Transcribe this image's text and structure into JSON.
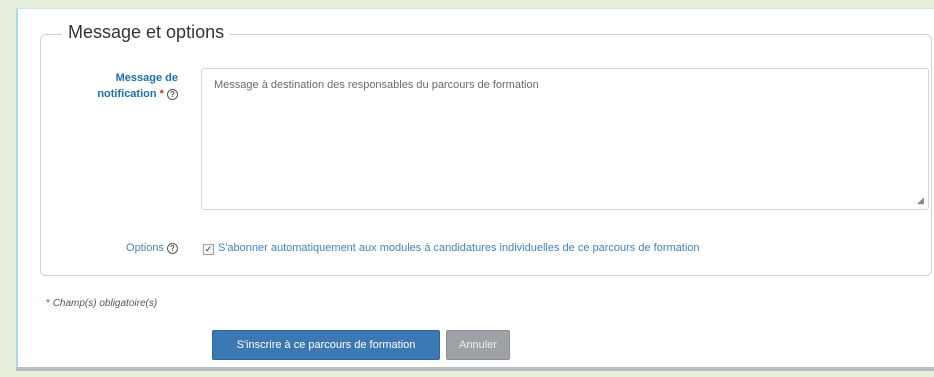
{
  "form": {
    "legend": "Message et options",
    "message_label": "Message de notification",
    "required_star": "*",
    "help_icon": "question-circle-icon",
    "message_value": "Message à destination des responsables du parcours de formation",
    "options_label": "Options",
    "auto_subscribe": {
      "checked": true,
      "label": "S'abonner automatiquement aux modules à candidatures individuelles de ce parcours de formation"
    },
    "required_note": "Champ(s) obligatoire(s)",
    "submit_label": "S'inscrire à ce parcours de formation",
    "cancel_label": "Annuler"
  },
  "colors": {
    "page_bg": "#e6f0dc",
    "label_blue": "#1f6fad",
    "primary_button": "#3c78b4",
    "cancel_button": "#9ea2a6"
  }
}
